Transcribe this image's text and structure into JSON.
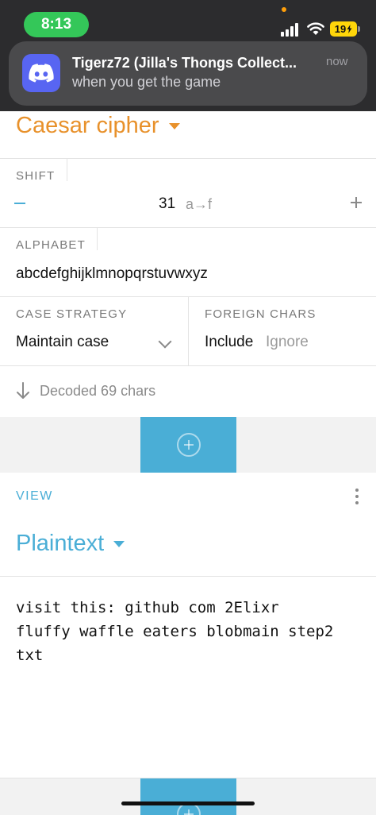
{
  "status_bar": {
    "time": "8:13",
    "battery": "19"
  },
  "notification": {
    "app_icon": "discord-icon",
    "title": "Tigerz72 (Jilla's Thongs Collect...",
    "body": "when you get the game",
    "time": "now"
  },
  "cipher": {
    "title": "Caesar cipher",
    "shift": {
      "label": "SHIFT",
      "value": "31",
      "mapping": "a→f"
    },
    "alphabet": {
      "label": "ALPHABET",
      "value": "abcdefghijklmnopqrstuvwxyz"
    },
    "case_strategy": {
      "label": "CASE STRATEGY",
      "value": "Maintain case"
    },
    "foreign_chars": {
      "label": "FOREIGN CHARS",
      "option_include": "Include",
      "option_ignore": "Ignore",
      "selected": "Include"
    },
    "status": "Decoded 69 chars"
  },
  "view": {
    "label": "VIEW",
    "format": "Plaintext",
    "output": "visit this: github com 2Elixr\nfluffy waffle eaters blobmain step2\ntxt"
  },
  "colors": {
    "accent_blue": "#4aaed6",
    "cipher_orange": "#e8912b",
    "discord": "#5865f2"
  }
}
